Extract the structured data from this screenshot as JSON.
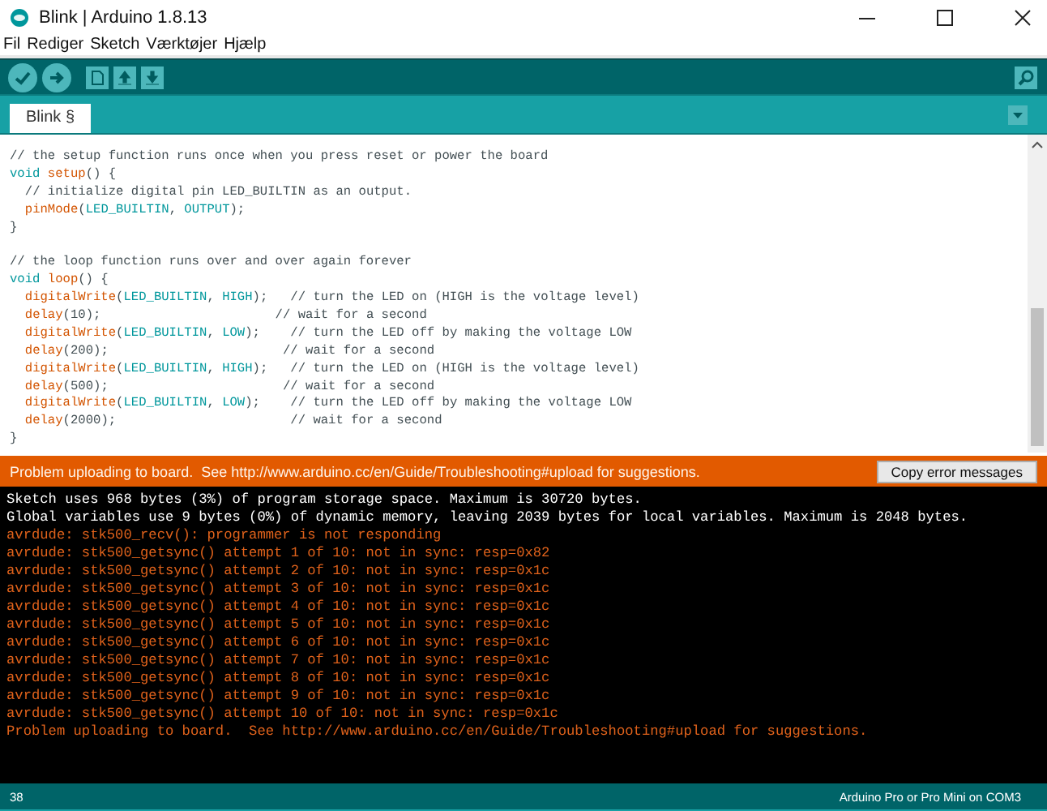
{
  "window": {
    "title": "Blink | Arduino 1.8.13"
  },
  "menu": [
    "Fil",
    "Rediger",
    "Sketch",
    "Værktøjer",
    "Hjælp"
  ],
  "tabs": [
    {
      "label": "Blink §",
      "selected": true
    }
  ],
  "editor": {
    "lines": [
      {
        "kind": "code",
        "indented": false,
        "tokens": [
          {
            "t": "// the setup function runs once when you press reset or power the board",
            "kind": "comment"
          }
        ]
      },
      {
        "kind": "code",
        "indented": false,
        "tokens": [
          {
            "t": "void ",
            "kind": "keyword"
          },
          {
            "t": "setup",
            "kind": "func"
          },
          {
            "t": "() {",
            "kind": "plain"
          }
        ]
      },
      {
        "kind": "code",
        "indented": true,
        "tokens": [
          {
            "t": "// initialize digital pin LED_BUILTIN as an output.",
            "kind": "comment"
          }
        ]
      },
      {
        "kind": "code",
        "indented": true,
        "tokens": [
          {
            "t": "pinMode",
            "kind": "func"
          },
          {
            "t": "(",
            "kind": "plain"
          },
          {
            "t": "LED_BUILTIN",
            "kind": "const"
          },
          {
            "t": ", ",
            "kind": "plain"
          },
          {
            "t": "OUTPUT",
            "kind": "const"
          },
          {
            "t": ");",
            "kind": "plain"
          }
        ]
      },
      {
        "kind": "code",
        "indented": false,
        "tokens": [
          {
            "t": "}",
            "kind": "plain"
          }
        ]
      },
      {
        "kind": "blank"
      },
      {
        "kind": "code",
        "indented": false,
        "tokens": [
          {
            "t": "// the loop function runs over and over again forever",
            "kind": "comment"
          }
        ]
      },
      {
        "kind": "code",
        "indented": false,
        "tokens": [
          {
            "t": "void ",
            "kind": "keyword"
          },
          {
            "t": "loop",
            "kind": "func"
          },
          {
            "t": "() {",
            "kind": "plain"
          }
        ]
      },
      {
        "kind": "code",
        "indented": true,
        "tokens": [
          {
            "t": "digitalWrite",
            "kind": "func"
          },
          {
            "t": "(",
            "kind": "plain"
          },
          {
            "t": "LED_BUILTIN",
            "kind": "const"
          },
          {
            "t": ", ",
            "kind": "plain"
          },
          {
            "t": "HIGH",
            "kind": "const"
          },
          {
            "t": ");   // turn the LED on (HIGH is the voltage level)",
            "kind": "plain"
          }
        ]
      },
      {
        "kind": "code",
        "indented": true,
        "tokens": [
          {
            "t": "delay",
            "kind": "func"
          },
          {
            "t": "(10);                       // wait for a second",
            "kind": "plain"
          }
        ]
      },
      {
        "kind": "code",
        "indented": true,
        "tokens": [
          {
            "t": "digitalWrite",
            "kind": "func"
          },
          {
            "t": "(",
            "kind": "plain"
          },
          {
            "t": "LED_BUILTIN",
            "kind": "const"
          },
          {
            "t": ", ",
            "kind": "plain"
          },
          {
            "t": "LOW",
            "kind": "const"
          },
          {
            "t": ");    // turn the LED off by making the voltage LOW",
            "kind": "plain"
          }
        ]
      },
      {
        "kind": "code",
        "indented": true,
        "tokens": [
          {
            "t": "delay",
            "kind": "func"
          },
          {
            "t": "(200);                       // wait for a second",
            "kind": "plain"
          }
        ]
      },
      {
        "kind": "code",
        "indented": true,
        "tokens": [
          {
            "t": "digitalWrite",
            "kind": "func"
          },
          {
            "t": "(",
            "kind": "plain"
          },
          {
            "t": "LED_BUILTIN",
            "kind": "const"
          },
          {
            "t": ", ",
            "kind": "plain"
          },
          {
            "t": "HIGH",
            "kind": "const"
          },
          {
            "t": ");   // turn the LED on (HIGH is the voltage level)",
            "kind": "plain"
          }
        ]
      },
      {
        "kind": "code",
        "indented": true,
        "tokens": [
          {
            "t": "delay",
            "kind": "func"
          },
          {
            "t": "(500);                       // wait for a second",
            "kind": "plain"
          }
        ]
      },
      {
        "kind": "code",
        "indented": true,
        "tokens": [
          {
            "t": "digitalWrite",
            "kind": "func"
          },
          {
            "t": "(",
            "kind": "plain"
          },
          {
            "t": "LED_BUILTIN",
            "kind": "const"
          },
          {
            "t": ", ",
            "kind": "plain"
          },
          {
            "t": "LOW",
            "kind": "const"
          },
          {
            "t": ");    // turn the LED off by making the voltage LOW",
            "kind": "plain"
          }
        ]
      },
      {
        "kind": "code",
        "indented": true,
        "tokens": [
          {
            "t": "delay",
            "kind": "func"
          },
          {
            "t": "(2000);                       // wait for a second",
            "kind": "plain"
          }
        ]
      },
      {
        "kind": "code",
        "indented": false,
        "tokens": [
          {
            "t": "}",
            "kind": "plain"
          }
        ]
      }
    ]
  },
  "error_bar": {
    "message": "Problem uploading to board.  See http://www.arduino.cc/en/Guide/Troubleshooting#upload for suggestions.",
    "button": "Copy error messages"
  },
  "console": [
    {
      "kind": "info",
      "text": "Sketch uses 968 bytes (3%) of program storage space. Maximum is 30720 bytes."
    },
    {
      "kind": "info",
      "text": "Global variables use 9 bytes (0%) of dynamic memory, leaving 2039 bytes for local variables. Maximum is 2048 bytes."
    },
    {
      "kind": "error",
      "text": "avrdude: stk500_recv(): programmer is not responding"
    },
    {
      "kind": "error",
      "text": "avrdude: stk500_getsync() attempt 1 of 10: not in sync: resp=0x82"
    },
    {
      "kind": "error",
      "text": "avrdude: stk500_getsync() attempt 2 of 10: not in sync: resp=0x1c"
    },
    {
      "kind": "error",
      "text": "avrdude: stk500_getsync() attempt 3 of 10: not in sync: resp=0x1c"
    },
    {
      "kind": "error",
      "text": "avrdude: stk500_getsync() attempt 4 of 10: not in sync: resp=0x1c"
    },
    {
      "kind": "error",
      "text": "avrdude: stk500_getsync() attempt 5 of 10: not in sync: resp=0x1c"
    },
    {
      "kind": "error",
      "text": "avrdude: stk500_getsync() attempt 6 of 10: not in sync: resp=0x1c"
    },
    {
      "kind": "error",
      "text": "avrdude: stk500_getsync() attempt 7 of 10: not in sync: resp=0x1c"
    },
    {
      "kind": "error",
      "text": "avrdude: stk500_getsync() attempt 8 of 10: not in sync: resp=0x1c"
    },
    {
      "kind": "error",
      "text": "avrdude: stk500_getsync() attempt 9 of 10: not in sync: resp=0x1c"
    },
    {
      "kind": "error",
      "text": "avrdude: stk500_getsync() attempt 10 of 10: not in sync: resp=0x1c"
    },
    {
      "kind": "error",
      "text": "Problem uploading to board.  See http://www.arduino.cc/en/Guide/Troubleshooting#upload for suggestions."
    }
  ],
  "status_bar": {
    "line": "38",
    "board": "Arduino Pro or Pro Mini on COM3"
  }
}
